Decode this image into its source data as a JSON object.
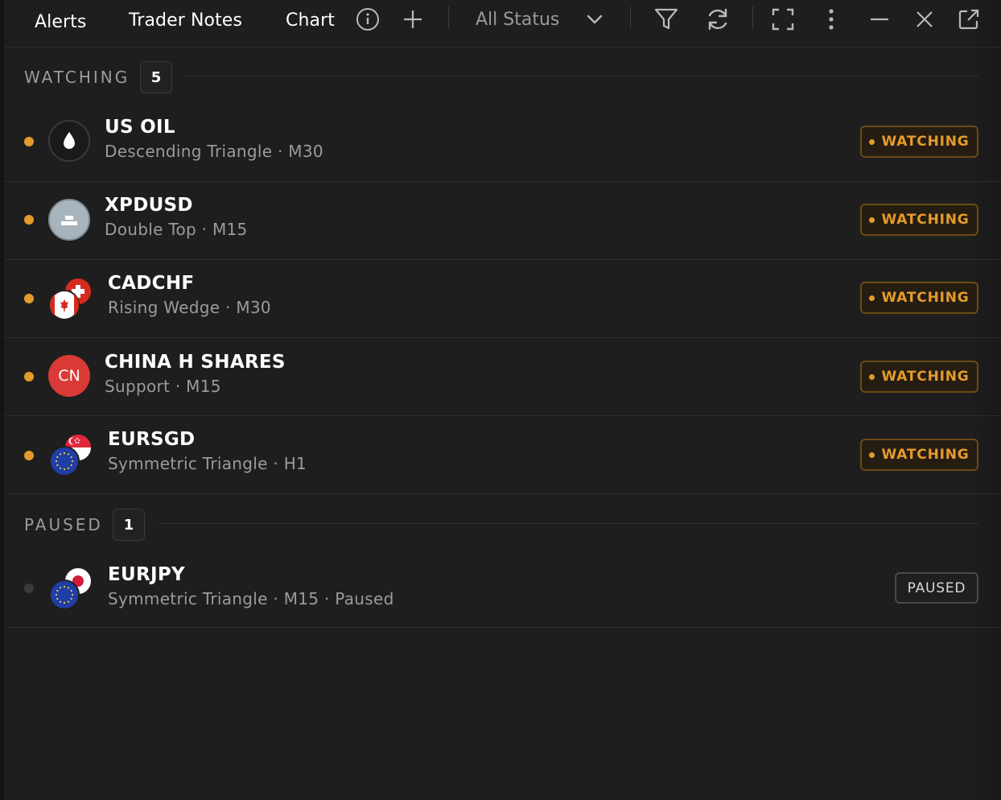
{
  "toolbar": {
    "tabs": [
      {
        "label": "Alerts"
      },
      {
        "label": "Trader Notes"
      },
      {
        "label": "Chart"
      }
    ],
    "status_filter": {
      "selected": "All Status"
    },
    "icons": [
      "info-icon",
      "plus-icon",
      "chevron-down-icon",
      "filter-icon",
      "refresh-icon",
      "expand-icon",
      "more-vertical-icon",
      "minimize-icon",
      "close-icon",
      "external-link-icon"
    ]
  },
  "sections": {
    "watching": {
      "label": "WATCHING",
      "count": "5"
    },
    "paused": {
      "label": "PAUSED",
      "count": "1"
    }
  },
  "alerts": [
    {
      "symbol": "US OIL",
      "detail": "Descending Triangle · M30",
      "status": "WATCHING",
      "icon": "oil-drop-icon"
    },
    {
      "symbol": "XPDUSD",
      "detail": "Double Top · M15",
      "status": "WATCHING",
      "icon": "metal-bar-icon"
    },
    {
      "symbol": "CADCHF",
      "detail": "Rising Wedge · M30",
      "status": "WATCHING",
      "icon": "canada-switzerland-flags-icon"
    },
    {
      "symbol": "CHINA H SHARES",
      "detail": "Support · M15",
      "status": "WATCHING",
      "icon": "cn-badge-icon",
      "avatar_text": "CN"
    },
    {
      "symbol": "EURSGD",
      "detail": "Symmetric Triangle · H1",
      "status": "WATCHING",
      "icon": "eu-singapore-flags-icon"
    },
    {
      "symbol": "EURJPY",
      "detail": "Symmetric Triangle · M15 · Paused",
      "status": "PAUSED",
      "icon": "eu-japan-flags-icon"
    }
  ],
  "colors": {
    "background": "#1e1e1e",
    "watching_accent": "#e59b2b",
    "paused_dot": "#3a3a3a",
    "cn_red": "#d93a36"
  }
}
